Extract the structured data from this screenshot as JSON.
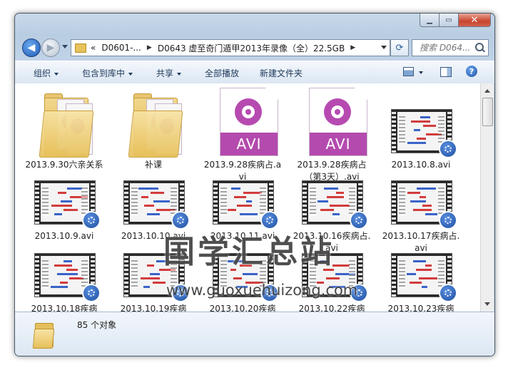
{
  "window": {
    "caption": {
      "minimize_icon": "minimize-icon",
      "maximize_icon": "maximize-icon",
      "close_icon": "close-icon"
    }
  },
  "nav": {
    "breadcrumb_overflow": "«",
    "crumbs": [
      "D0601-...",
      "D0643 虚至奇门遁甲2013年录像（全）22.5GB"
    ],
    "search_placeholder": "搜索 D064..."
  },
  "commands": {
    "organize": "组织",
    "include_in_library": "包含到库中",
    "share": "共享",
    "play_all": "全部播放",
    "new_folder": "新建文件夹"
  },
  "items": [
    {
      "type": "folder",
      "name": "2013.9.30六亲关系"
    },
    {
      "type": "folder",
      "name": "补课"
    },
    {
      "type": "avi",
      "name": "2013.9.28疾病占.avi",
      "icon_label": "AVI"
    },
    {
      "type": "avi",
      "name": "2013.9.28疾病占（第3天）.avi",
      "icon_label": "AVI"
    },
    {
      "type": "video",
      "name": "2013.10.8.avi"
    },
    {
      "type": "video",
      "name": "2013.10.9.avi"
    },
    {
      "type": "video",
      "name": "2013.10.10.avi"
    },
    {
      "type": "video",
      "name": "2013.10.11.avi"
    },
    {
      "type": "video",
      "name": "2013.10.16疾病占.avi"
    },
    {
      "type": "video",
      "name": "2013.10.17疾病占.avi"
    },
    {
      "type": "video",
      "name": "2013.10.18疾病"
    },
    {
      "type": "video",
      "name": "2013.10.19疾病"
    },
    {
      "type": "video",
      "name": "2013.10.20疾病"
    },
    {
      "type": "video",
      "name": "2013.10.22疾病"
    },
    {
      "type": "video",
      "name": "2013.10.23疾病"
    }
  ],
  "watermark": {
    "text": "国学汇总站",
    "url": "www.guoxuehuizong.com"
  },
  "details": {
    "count_text": "85 个对象"
  },
  "colors": {
    "accent": "#1e395b",
    "avi_purple": "#b44aae",
    "folder_yellow": "#e7c15a"
  }
}
